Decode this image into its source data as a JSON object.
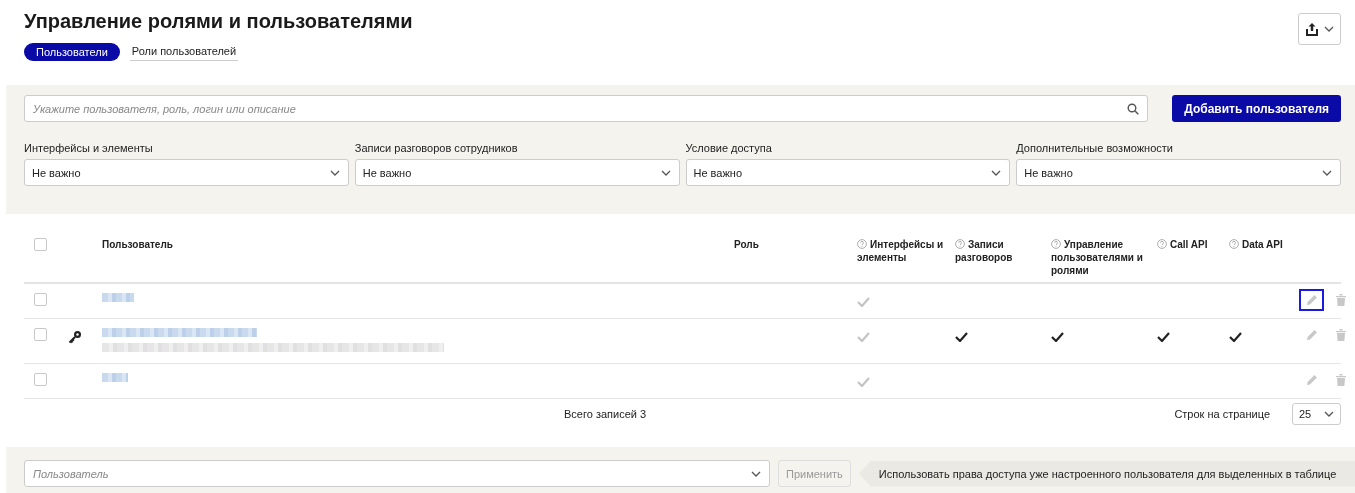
{
  "page": {
    "title": "Управление ролями и пользователями"
  },
  "tabs": [
    {
      "label": "Пользователи",
      "selected": true
    },
    {
      "label": "Роли пользователей",
      "selected": false
    }
  ],
  "search": {
    "placeholder": "Укажите пользователя, роль, логин или описание"
  },
  "add_button": "Добавить пользователя",
  "filters": [
    {
      "label": "Интерфейсы и элементы",
      "value": "Не важно"
    },
    {
      "label": "Записи разговоров сотрудников",
      "value": "Не важно"
    },
    {
      "label": "Условие доступа",
      "value": "Не важно"
    },
    {
      "label": "Дополнительные возможности",
      "value": "Не важно"
    }
  ],
  "table": {
    "select_all_checked": false,
    "columns": [
      {
        "label": "Пользователь",
        "help": false
      },
      {
        "label": "Роль",
        "help": false
      },
      {
        "label": "Интерфейсы и элементы",
        "help": true
      },
      {
        "label": "Записи разговоров",
        "help": true
      },
      {
        "label": "Управление пользователями и ролями",
        "help": true
      },
      {
        "label": "Call API",
        "help": true
      },
      {
        "label": "Data API",
        "help": true
      }
    ],
    "rows": [
      {
        "checked": false,
        "has_key": false,
        "name_redacted": true,
        "description_redacted": false,
        "access": [
          {
            "kind": "inherited"
          },
          {
            "kind": "none"
          },
          {
            "kind": "none"
          },
          {
            "kind": "none"
          },
          {
            "kind": "none"
          }
        ],
        "edit_focused": true
      },
      {
        "checked": false,
        "has_key": true,
        "name_redacted": true,
        "description_redacted": true,
        "access": [
          {
            "kind": "inherited"
          },
          {
            "kind": "granted"
          },
          {
            "kind": "granted"
          },
          {
            "kind": "granted"
          },
          {
            "kind": "granted"
          }
        ],
        "edit_focused": false
      },
      {
        "checked": false,
        "has_key": false,
        "name_redacted": true,
        "description_redacted": false,
        "access": [
          {
            "kind": "inherited"
          },
          {
            "kind": "none"
          },
          {
            "kind": "none"
          },
          {
            "kind": "none"
          },
          {
            "kind": "none"
          }
        ],
        "edit_focused": false
      }
    ]
  },
  "footer": {
    "total": "Всего записей 3",
    "rows_per_page_label": "Строк на странице",
    "rows_per_page": "25"
  },
  "bulk": {
    "placeholder": "Пользователь",
    "apply_button": "Применить",
    "apply_disabled": true,
    "hint": "Использовать права доступа уже настроенного пользователя для выделенных в таблице"
  }
}
